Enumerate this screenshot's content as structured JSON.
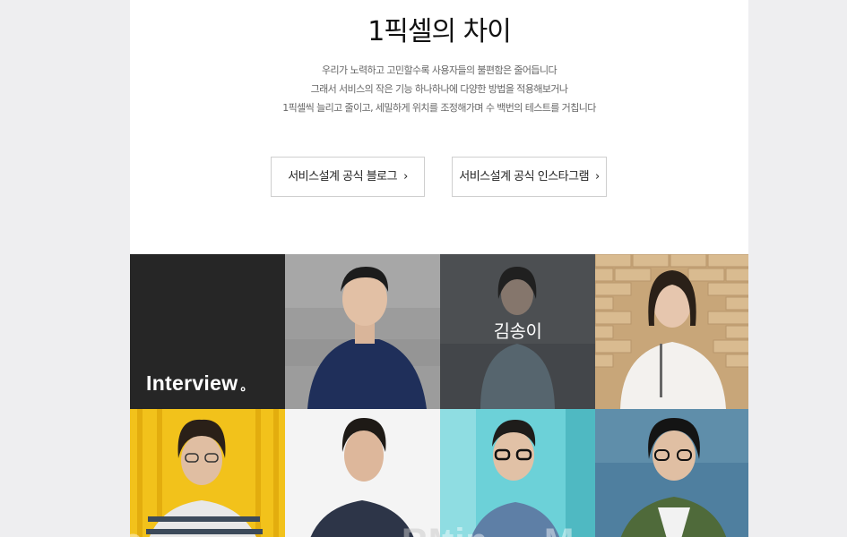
{
  "section": {
    "title": "1픽셀의 차이",
    "description": [
      "우리가 노력하고 고민할수록 사용자들의 불편함은 줄어듭니다",
      "그래서 서비스의 작은 기능 하나하나에 다양한 방법을 적용해보거나",
      "1픽셀씩 늘리고 줄이고, 세밀하게 위치를 조정해가며 수 백번의 테스트를 거칩니다"
    ]
  },
  "buttons": {
    "blog": "서비스설계 공식 블로그",
    "instagram": "서비스설계 공식 인스타그램",
    "chevron": "›"
  },
  "interview": {
    "label": "Interview",
    "dot": "。",
    "hover_name": "김송이",
    "bg_words": [
      "e",
      "RM",
      "tin",
      "M."
    ]
  },
  "colors": {
    "page_bg": "#eeeef0",
    "interview_tile": "#262626",
    "yellow_tile": "#f2c21b",
    "cyan_tile": "#6cd1d8",
    "blue_tile": "#4f7f9f"
  }
}
